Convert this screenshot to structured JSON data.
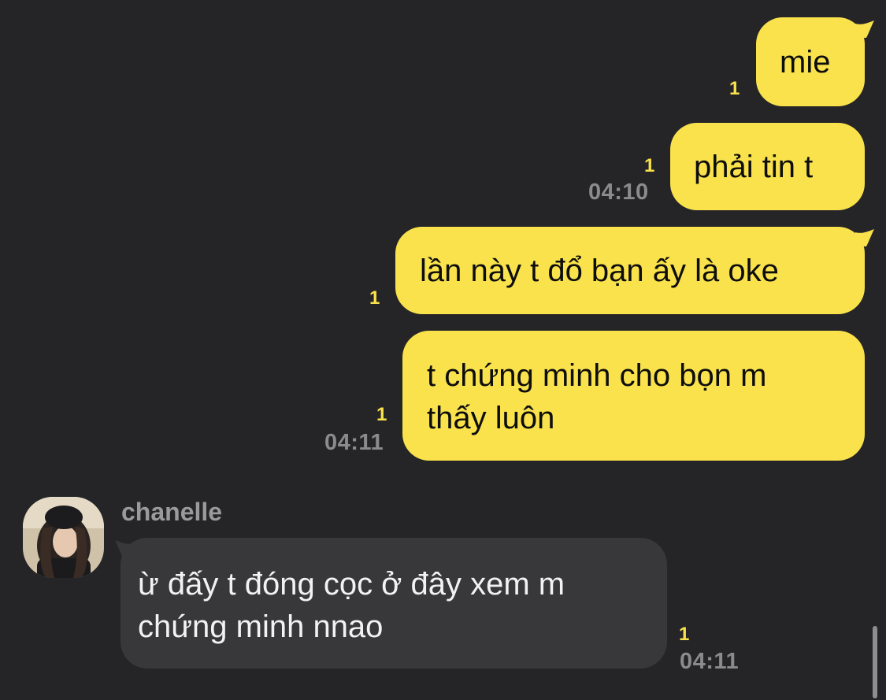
{
  "messages": [
    {
      "text": "mie",
      "unread": "1",
      "time": ""
    },
    {
      "text": "phải tin t",
      "unread": "1",
      "time": "04:10"
    },
    {
      "text": "lần này t đổ bạn ấy là oke",
      "unread": "1",
      "time": ""
    },
    {
      "text_lines": [
        "t chứng minh cho bọn m",
        "thấy luôn"
      ],
      "unread": "1",
      "time": "04:11"
    }
  ],
  "incoming": {
    "sender": "chanelle",
    "avatar_icon": "profile-photo",
    "text_lines": [
      "ừ đấy t đóng cọc ở đây xem m",
      "chứng minh nnao"
    ],
    "unread": "1",
    "time": "04:11"
  },
  "colors": {
    "background": "#252527",
    "outgoing_bubble": "#F9E24B",
    "incoming_bubble": "#38383B",
    "unread_count": "#F9E24B",
    "timestamp": "#8b8b8e"
  }
}
